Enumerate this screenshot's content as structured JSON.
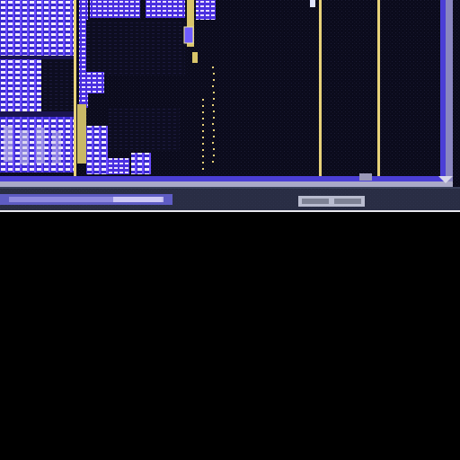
{
  "image": {
    "subject": "chip-die-micrograph-corner",
    "colors": {
      "background": "#000000",
      "substrate": "#0b0b1c",
      "metal_blue": "#5a3cff",
      "metal_violet": "#8a5cff",
      "highlight": "#f4f0ff",
      "gold_trace": "#e8d27a",
      "seal_ring": "#4b3fd6",
      "border_grey": "#b9b9c9"
    },
    "label_block_text": [
      " ",
      " "
    ]
  }
}
